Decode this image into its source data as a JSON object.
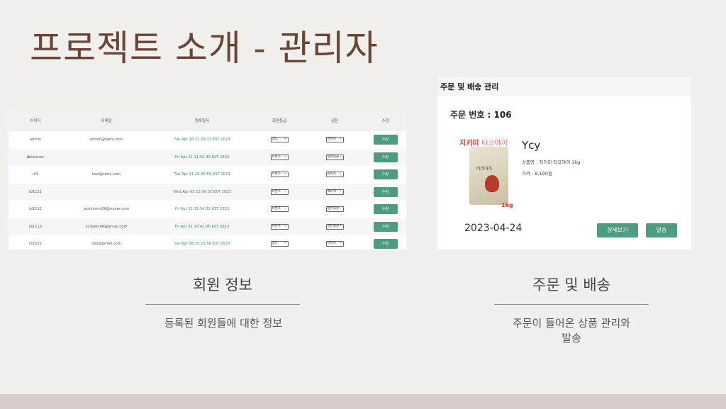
{
  "slide": {
    "title": "프로젝트 소개 - 관리자"
  },
  "members": {
    "columns": [
      "아이디",
      "이메일",
      "등록일자",
      "회원등급",
      "권한",
      "수정"
    ],
    "rows": [
      {
        "id": "admin",
        "email": "admin@semi.com",
        "date": "Tue Apr 18 21:28:13 KST 2023",
        "grade": "골드",
        "role": "관리자",
        "action": "수정"
      },
      {
        "id": "deletuser",
        "email": "",
        "date": "Fri Apr 21 11:50:39 KST 2023",
        "grade": "브론즈",
        "role": "일반회원",
        "action": "수정"
      },
      {
        "id": "id1",
        "email": "test@semi.com",
        "date": "Tue Apr 11 16:36:58 KST 2023",
        "grade": "브론즈",
        "role": "관리자",
        "action": "수정"
      },
      {
        "id": "id1111",
        "email": "",
        "date": "Wed Apr 05 15:56:32 KST 2023",
        "grade": "브론즈",
        "role": "매니저",
        "action": "수정"
      },
      {
        "id": "id1112",
        "email": "jeonhmnx06@naver.com",
        "date": "Fri Apr 21 11:54:32 KST 2023",
        "grade": "브론즈",
        "role": "일반회원",
        "action": "수정"
      },
      {
        "id": "id1113",
        "email": "yciyeon06@gmail.com",
        "date": "Fri Apr 21 10:42:06 KST 2023",
        "grade": "브론즈",
        "role": "일반회원",
        "action": "수정"
      },
      {
        "id": "id2222",
        "email": "ooo@gmail.com",
        "date": "Sat Apr 08 15:15:56 KST 2023",
        "grade": "골드",
        "role": "관리자",
        "action": "수정"
      }
    ]
  },
  "order": {
    "header": "주문 및 배송 관리",
    "order_no": "주문 번호 : 106",
    "image_text": {
      "brand": "지키미",
      "product": "타코야끼",
      "bag_label": "타코야끼",
      "weight": "1kg"
    },
    "customer": "Ycy",
    "product_line": "상품명 :   지키미 타코야끼 1kg",
    "price_line": "가격 :    8,190원",
    "date": "2023-04-24",
    "detail_button": "상세보기",
    "ship_button": "발송"
  },
  "captions": {
    "left": {
      "title": "회원 정보",
      "desc": "등록된 회원들에 대한 정보"
    },
    "right": {
      "title": "주문 및 배송",
      "desc_line1": "주문이 들어온 상품 관리와",
      "desc_line2": "발송"
    }
  },
  "colors": {
    "title": "#6b4438",
    "accent": "#4e9c82",
    "background": "#f2f0ec",
    "footer": "#d7cdca"
  }
}
